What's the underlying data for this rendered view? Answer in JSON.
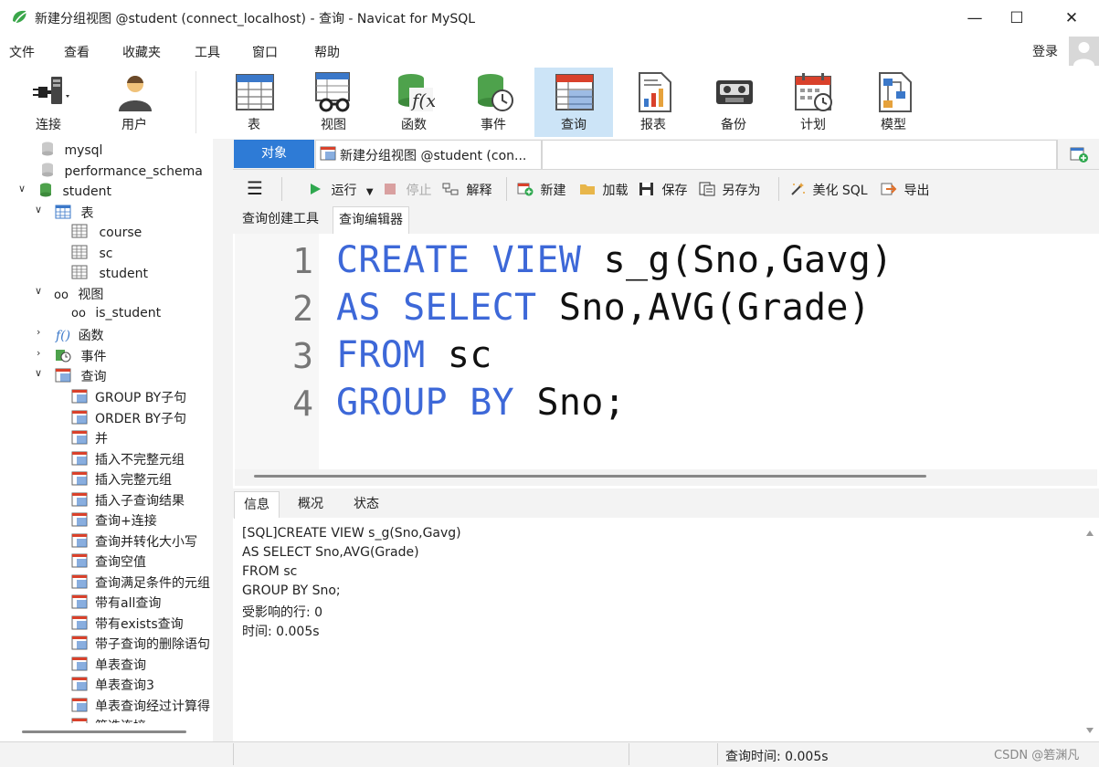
{
  "window": {
    "title": "新建分组视图 @student (connect_localhost) - 查询 - Navicat for MySQL",
    "minimize_glyph": "—",
    "maximize_glyph": "☐",
    "close_glyph": "✕"
  },
  "menu": {
    "items": [
      "文件",
      "查看",
      "收藏夹",
      "工具",
      "窗口",
      "帮助"
    ],
    "login": "登录"
  },
  "toolbar": {
    "items": [
      {
        "label": "连接",
        "icon": "plug-connect-icon"
      },
      {
        "label": "用户",
        "icon": "user-icon"
      },
      {
        "label": "表",
        "icon": "table-icon"
      },
      {
        "label": "视图",
        "icon": "view-glasses-icon"
      },
      {
        "label": "函数",
        "icon": "function-icon"
      },
      {
        "label": "事件",
        "icon": "event-clock-icon"
      },
      {
        "label": "查询",
        "icon": "query-icon"
      },
      {
        "label": "报表",
        "icon": "report-icon"
      },
      {
        "label": "备份",
        "icon": "backup-tape-icon"
      },
      {
        "label": "计划",
        "icon": "calendar-schedule-icon"
      },
      {
        "label": "模型",
        "icon": "model-icon"
      }
    ],
    "active": "查询"
  },
  "sidebar": {
    "dbs": [
      "mysql",
      "performance_schema"
    ],
    "current_db": "student",
    "tables_label": "表",
    "tables": [
      "course",
      "sc",
      "student"
    ],
    "views_label": "视图",
    "views": [
      "is_student"
    ],
    "functions_label": "函数",
    "events_label": "事件",
    "queries_label": "查询",
    "queries": [
      "GROUP BY子句",
      "ORDER BY子句",
      "并",
      "插入不完整元组",
      "插入完整元组",
      "插入子查询结果",
      "查询+连接",
      "查询并转化大小写",
      "查询空值",
      "查询满足条件的元组",
      "带有all查询",
      "带有exists查询",
      "带子查询的删除语句",
      "单表查询",
      "单表查询3",
      "单表查询经过计算得",
      "筛选连接"
    ]
  },
  "tabs": {
    "objects": "对象",
    "query": "新建分组视图 @student (con..."
  },
  "query_toolbar": {
    "menu_glyph": "☰",
    "run": "运行",
    "stop": "停止",
    "explain": "解释",
    "new": "新建",
    "load": "加载",
    "save": "保存",
    "save_as": "另存为",
    "beautify": "美化 SQL",
    "export": "导出"
  },
  "subtabs": [
    "查询创建工具",
    "查询编辑器"
  ],
  "editor": {
    "line_numbers": [
      "1",
      "2",
      "3",
      "4"
    ],
    "lines": [
      [
        {
          "t": "CREATE VIEW",
          "k": true
        },
        {
          "t": " s_g(Sno,Gavg)",
          "k": false
        }
      ],
      [
        {
          "t": "AS SELECT",
          "k": true
        },
        {
          "t": " Sno,AVG(Grade)",
          "k": false
        }
      ],
      [
        {
          "t": "FROM",
          "k": true
        },
        {
          "t": " sc",
          "k": false
        }
      ],
      [
        {
          "t": "GROUP BY",
          "k": true
        },
        {
          "t": " Sno;",
          "k": false
        }
      ]
    ]
  },
  "info_tabs": [
    "信息",
    "概况",
    "状态"
  ],
  "info": {
    "lines": [
      "[SQL]CREATE VIEW s_g(Sno,Gavg)",
      "AS SELECT Sno,AVG(Grade)",
      "FROM sc",
      "GROUP BY Sno;",
      "受影响的行: 0",
      "时间: 0.005s"
    ]
  },
  "status": {
    "query_time": "查询时间: 0.005s"
  },
  "watermark": "CSDN @箬渊凡",
  "colors": {
    "keyword": "#3d68d8",
    "accent": "#2e7bd6",
    "active_toolbar": "#cce4f7",
    "run_green": "#2fa84f"
  }
}
